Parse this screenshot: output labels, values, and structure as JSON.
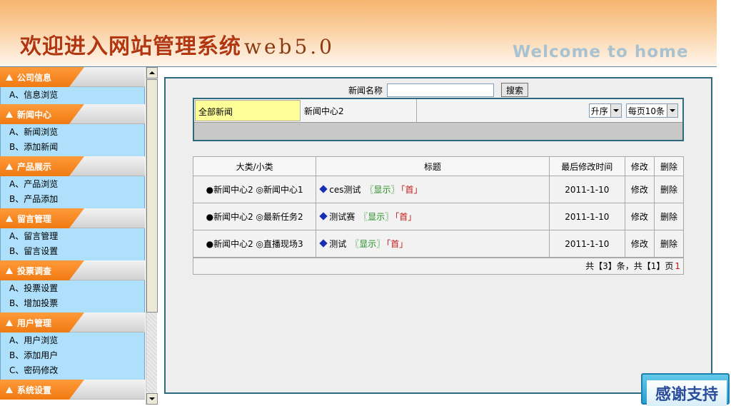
{
  "header": {
    "title": "欢迎进入网站管理系统",
    "version": "web5.0",
    "welcome": "Welcome to home"
  },
  "sidebar": {
    "sections": [
      {
        "title": "公司信息",
        "items": [
          "A、信息浏览"
        ]
      },
      {
        "title": "新闻中心",
        "items": [
          "A、新闻浏览",
          "B、添加新闻"
        ]
      },
      {
        "title": "产品展示",
        "items": [
          "A、产品浏览",
          "B、产品添加"
        ]
      },
      {
        "title": "留言管理",
        "items": [
          "A、留言管理",
          "B、留言设置"
        ]
      },
      {
        "title": "投票调查",
        "items": [
          "A、投票设置",
          "B、增加投票"
        ]
      },
      {
        "title": "用户管理",
        "items": [
          "A、用户浏览",
          "B、添加用户",
          "C、密码修改"
        ]
      },
      {
        "title": "系统设置",
        "items": []
      }
    ]
  },
  "search": {
    "label": "新闻名称",
    "value": "",
    "button": "搜索"
  },
  "filter": {
    "all": "全部新闻",
    "category": "新闻中心2",
    "sort": "升序",
    "per_page": "每页10条"
  },
  "table": {
    "headers": [
      "大类/小类",
      "标题",
      "最后修改时间",
      "修改",
      "删除"
    ],
    "rows": [
      {
        "category": "●新闻中心2 ◎新闻中心1",
        "title": "ces测试",
        "show": "〖显示〗",
        "home": "「首」",
        "time": "2011-1-10",
        "edit": "修改",
        "delete": "删除"
      },
      {
        "category": "●新闻中心2 ◎最新任务2",
        "title": "测试赛",
        "show": "〖显示〗",
        "home": "「首」",
        "time": "2011-1-10",
        "edit": "修改",
        "delete": "删除"
      },
      {
        "category": "●新闻中心2 ◎直播现场3",
        "title": "测试",
        "show": "〖显示〗",
        "home": "「首」",
        "time": "2011-1-10",
        "edit": "修改",
        "delete": "删除"
      }
    ]
  },
  "pager": {
    "summary": "共【3】条，共【1】页",
    "page": "1"
  },
  "thanks": "感谢支持"
}
